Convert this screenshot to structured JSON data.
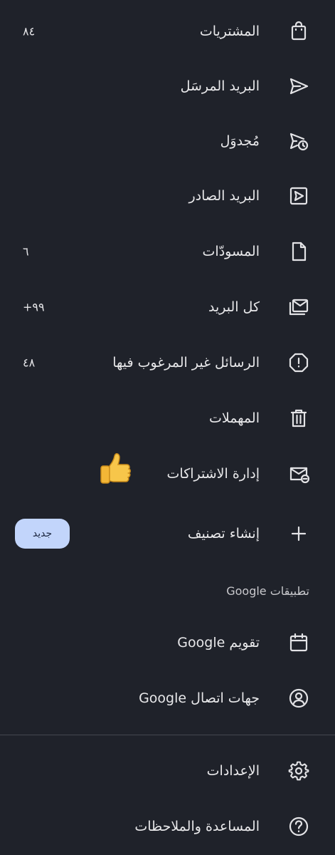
{
  "menu": {
    "items": [
      {
        "label": "المشتريات",
        "icon": "shopping-bag-icon",
        "count": "٨٤"
      },
      {
        "label": "البريد المرسَل",
        "icon": "send-icon",
        "count": ""
      },
      {
        "label": "مُجدوَل",
        "icon": "scheduled-send-icon",
        "count": ""
      },
      {
        "label": "البريد الصادر",
        "icon": "outbox-icon",
        "count": ""
      },
      {
        "label": "المسودّات",
        "icon": "draft-icon",
        "count": "٦"
      },
      {
        "label": "كل البريد",
        "icon": "all-mail-icon",
        "count": "+٩٩"
      },
      {
        "label": "الرسائل غير المرغوب فيها",
        "icon": "spam-icon",
        "count": "٤٨"
      },
      {
        "label": "المهملات",
        "icon": "trash-icon",
        "count": ""
      },
      {
        "label": "إدارة الاشتراكات",
        "icon": "manage-subscriptions-icon",
        "count": ""
      }
    ],
    "create_label": {
      "label": "إنشاء تصنيف",
      "badge": "جديد"
    }
  },
  "google_apps": {
    "title": "تطبيقات Google",
    "items": [
      {
        "label": "تقويم Google",
        "icon": "calendar-icon"
      },
      {
        "label": "جهات اتصال Google",
        "icon": "contacts-icon"
      }
    ]
  },
  "footer": {
    "items": [
      {
        "label": "الإعدادات",
        "icon": "settings-icon"
      },
      {
        "label": "المساعدة والملاحظات",
        "icon": "help-icon"
      }
    ]
  },
  "colors": {
    "background": "#1f222a",
    "text": "#e3e3e6",
    "badge": "#c2d5fb"
  }
}
